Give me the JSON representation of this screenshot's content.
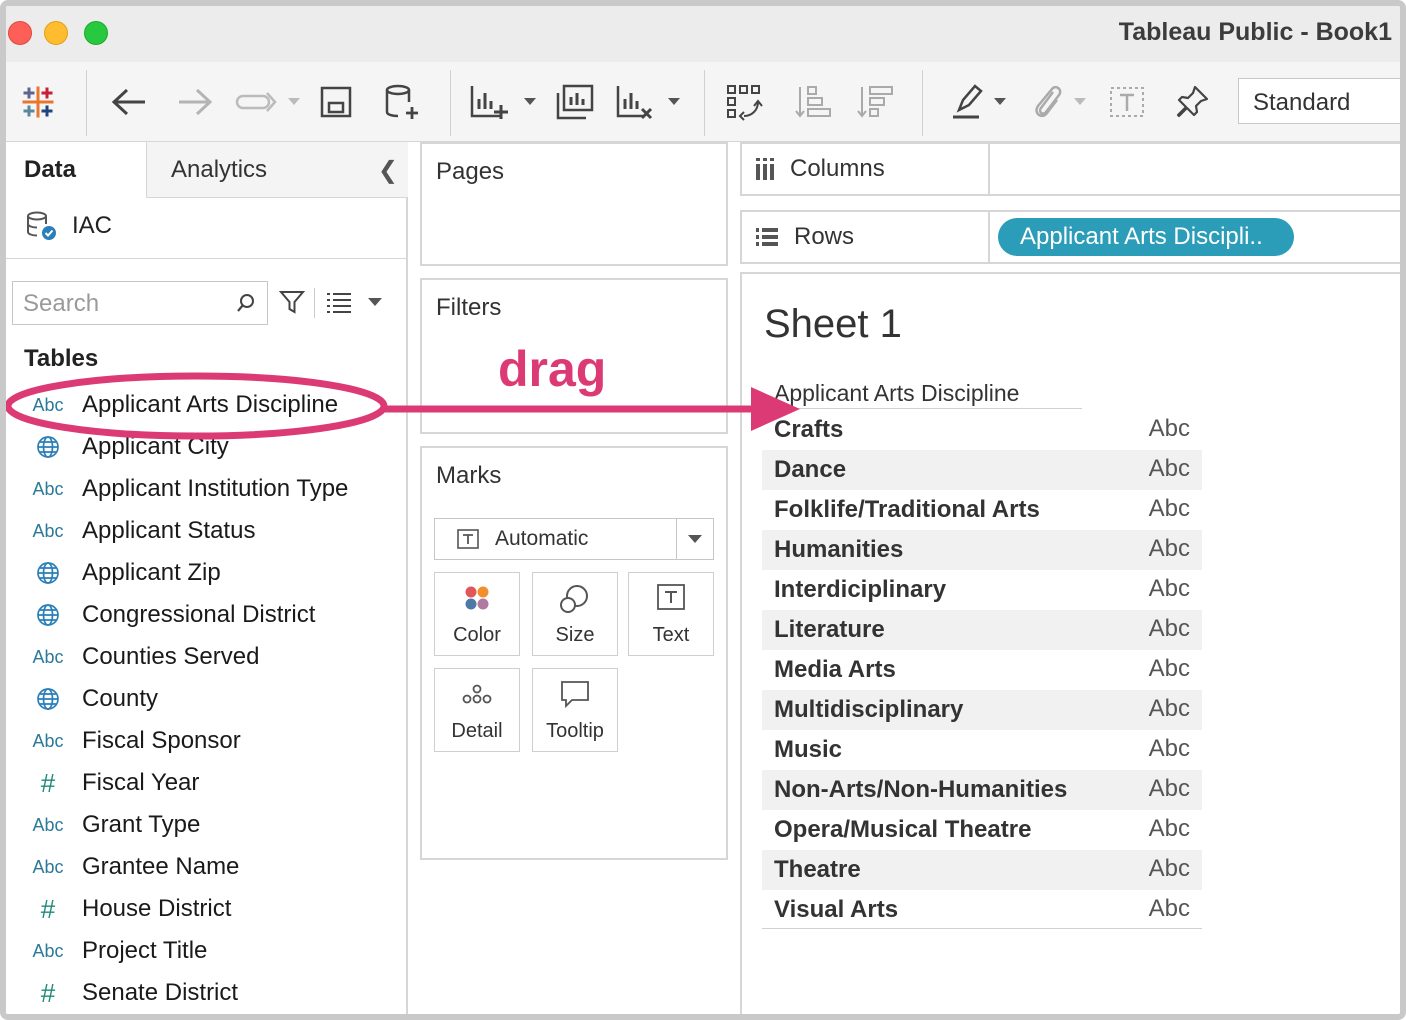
{
  "window": {
    "title": "Tableau Public - Book1"
  },
  "toolbar": {
    "view_size": "Standard"
  },
  "data_pane": {
    "tabs": [
      "Data",
      "Analytics"
    ],
    "datasource": "IAC",
    "search_placeholder": "Search",
    "tables_heading": "Tables",
    "fields": [
      {
        "type": "Abc",
        "name": "Applicant Arts Discipline"
      },
      {
        "type": "globe",
        "name": "Applicant City"
      },
      {
        "type": "Abc",
        "name": "Applicant Institution Type"
      },
      {
        "type": "Abc",
        "name": "Applicant Status"
      },
      {
        "type": "globe",
        "name": "Applicant Zip"
      },
      {
        "type": "globe",
        "name": "Congressional District"
      },
      {
        "type": "Abc",
        "name": "Counties Served"
      },
      {
        "type": "globe",
        "name": "County"
      },
      {
        "type": "Abc",
        "name": "Fiscal Sponsor"
      },
      {
        "type": "#",
        "name": "Fiscal Year"
      },
      {
        "type": "Abc",
        "name": "Grant Type"
      },
      {
        "type": "Abc",
        "name": "Grantee Name"
      },
      {
        "type": "#",
        "name": "House District"
      },
      {
        "type": "Abc",
        "name": "Project Title"
      },
      {
        "type": "#",
        "name": "Senate District"
      }
    ]
  },
  "cards": {
    "pages": "Pages",
    "filters": "Filters",
    "marks": "Marks",
    "mark_type": "Automatic",
    "mark_buttons": [
      "Color",
      "Size",
      "Text",
      "Detail",
      "Tooltip"
    ]
  },
  "shelves": {
    "columns_label": "Columns",
    "rows_label": "Rows",
    "rows_pill": "Applicant Arts Discipli.."
  },
  "annotation": {
    "text": "drag",
    "color": "#dc3a75"
  },
  "view": {
    "sheet_title": "Sheet 1",
    "column_header": "Applicant Arts Discipline",
    "rows": [
      {
        "label": "Crafts",
        "value": "Abc"
      },
      {
        "label": "Dance",
        "value": "Abc"
      },
      {
        "label": "Folklife/Traditional Arts",
        "value": "Abc"
      },
      {
        "label": "Humanities",
        "value": "Abc"
      },
      {
        "label": "Interdiciplinary",
        "value": "Abc"
      },
      {
        "label": "Literature",
        "value": "Abc"
      },
      {
        "label": "Media Arts",
        "value": "Abc"
      },
      {
        "label": "Multidisciplinary",
        "value": "Abc"
      },
      {
        "label": "Music",
        "value": "Abc"
      },
      {
        "label": "Non-Arts/Non-Humanities",
        "value": "Abc"
      },
      {
        "label": "Opera/Musical Theatre",
        "value": "Abc"
      },
      {
        "label": "Theatre",
        "value": "Abc"
      },
      {
        "label": "Visual Arts",
        "value": "Abc"
      }
    ]
  },
  "colors": {
    "pill": "#2c9db8",
    "accent": "#dc3a75"
  }
}
